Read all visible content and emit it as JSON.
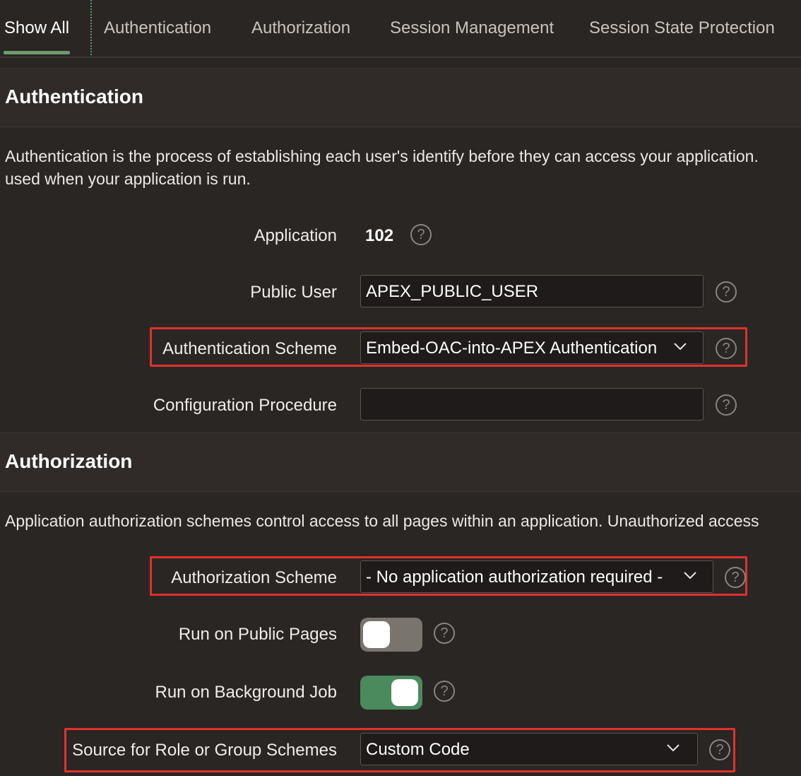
{
  "tabs": [
    {
      "label": "Show All",
      "active": true
    },
    {
      "label": "Authentication"
    },
    {
      "label": "Authorization"
    },
    {
      "label": "Session Management"
    },
    {
      "label": "Session State Protection"
    }
  ],
  "authentication": {
    "title": "Authentication",
    "description_line1": "Authentication is the process of establishing each user's identify before they can access your application.",
    "description_line2": "used when your application is run.",
    "application_label": "Application",
    "application_value": "102",
    "public_user_label": "Public User",
    "public_user_value": "APEX_PUBLIC_USER",
    "scheme_label": "Authentication Scheme",
    "scheme_value": "Embed-OAC-into-APEX Authentication",
    "config_label": "Configuration Procedure",
    "config_value": ""
  },
  "authorization": {
    "title": "Authorization",
    "description": "Application authorization schemes control access to all pages within an application. Unauthorized access",
    "scheme_label": "Authorization Scheme",
    "scheme_value": "- No application authorization required -",
    "public_pages_label": "Run on Public Pages",
    "public_pages_on": false,
    "background_job_label": "Run on Background Job",
    "background_job_on": true,
    "source_label": "Source for Role or Group Schemes",
    "source_value": "Custom Code"
  },
  "help_glyph": "?",
  "colors": {
    "highlight": "#e0322c",
    "toggle_on": "#4a8a5c",
    "tab_accent": "#6f9a6a"
  }
}
